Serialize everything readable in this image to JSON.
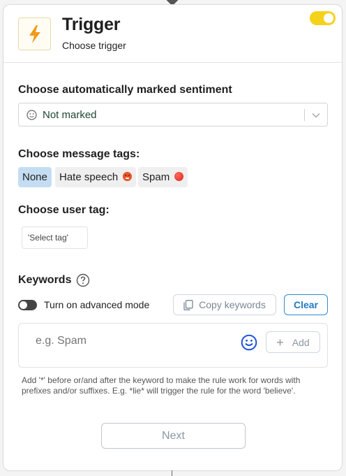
{
  "header": {
    "title": "Trigger",
    "subtitle": "Choose trigger",
    "enabled": true,
    "icon": "lightning-bolt-icon",
    "accent_color": "#f5d21a"
  },
  "sentiment": {
    "label": "Choose automatically marked sentiment",
    "selected": "Not marked",
    "icon": "neutral-face-icon"
  },
  "message_tags": {
    "label": "Choose message tags:",
    "options": [
      {
        "label": "None",
        "emoji": "",
        "active": true
      },
      {
        "label": "Hate speech",
        "emoji": "angry-face-icon",
        "active": false
      },
      {
        "label": "Spam",
        "emoji": "red-circle-icon",
        "active": false
      }
    ]
  },
  "user_tag": {
    "label": "Choose user tag:",
    "placeholder": "'Select tag'"
  },
  "keywords": {
    "label": "Keywords",
    "advanced_mode_label": "Turn on advanced mode",
    "advanced_mode": false,
    "copy_label": "Copy keywords",
    "clear_label": "Clear",
    "input_placeholder": "e.g. Spam",
    "add_label": "Add",
    "hint": "Add '*' before or/and after the keyword to make the rule work for words with prefixes and/or suffixes. E.g. *lie* will trigger the rule for the word 'believe'."
  },
  "footer": {
    "next_label": "Next"
  }
}
